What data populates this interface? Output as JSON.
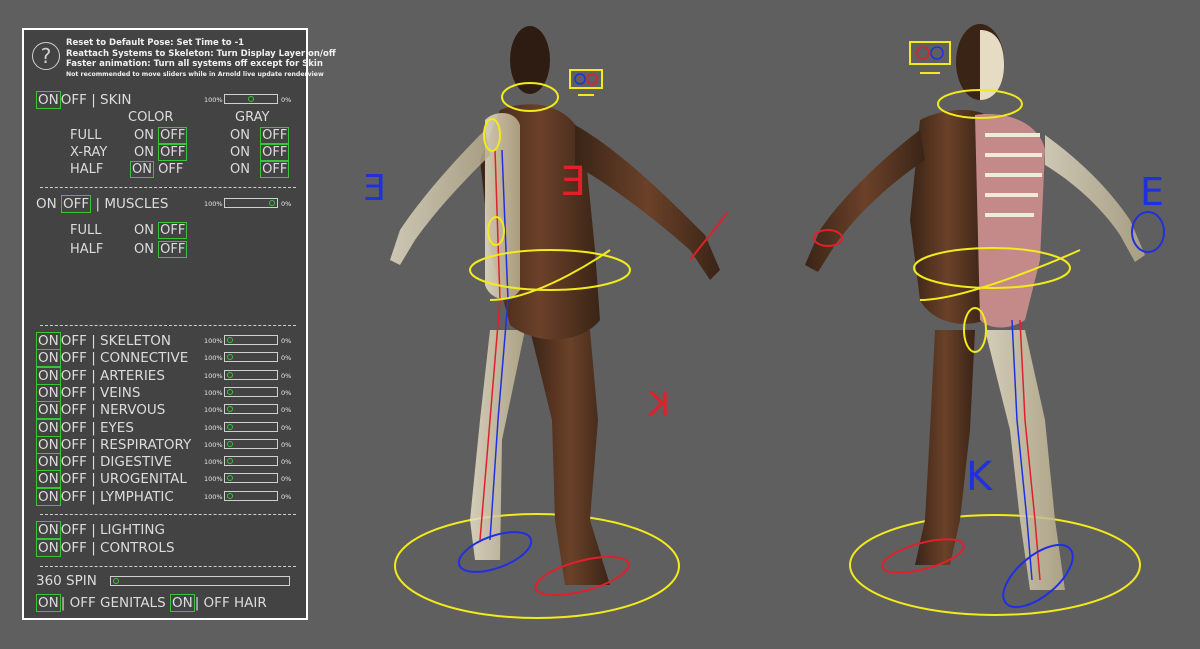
{
  "panel": {
    "help_icon": "?",
    "notes": [
      "Reset to Default Pose: Set Time to -1",
      "Reattach Systems to Skeleton: Turn Display Layer on/off",
      "Faster animation: Turn all systems off except for Skin",
      "Not recommended to move sliders while in Arnold live update renderview"
    ],
    "on_label": "ON",
    "off_label": "OFF",
    "pct_100": "100%",
    "pct_0": "0%",
    "skin": {
      "label": "| SKIN",
      "color_header": "COLOR",
      "gray_header": "GRAY",
      "rows": [
        {
          "name": "FULL",
          "color_selected": "OFF",
          "gray_selected": "OFF"
        },
        {
          "name": "X-RAY",
          "color_selected": "OFF",
          "gray_selected": "OFF"
        },
        {
          "name": "HALF",
          "color_selected": "ON",
          "gray_selected": "OFF"
        }
      ],
      "opacity": 0.5
    },
    "muscles": {
      "label": "| MUSCLES",
      "rows": [
        {
          "name": "FULL",
          "selected": "OFF"
        },
        {
          "name": "HALF",
          "selected": "OFF"
        }
      ],
      "opacity": 0.0
    },
    "systems": [
      {
        "label": "| SKELETON"
      },
      {
        "label": "| CONNECTIVE"
      },
      {
        "label": "| ARTERIES"
      },
      {
        "label": "| VEINS"
      },
      {
        "label": "| NERVOUS"
      },
      {
        "label": "| EYES"
      },
      {
        "label": "| RESPIRATORY"
      },
      {
        "label": "| DIGESTIVE"
      },
      {
        "label": "| UROGENITAL"
      },
      {
        "label": "| LYMPHATIC"
      }
    ],
    "scene": [
      {
        "label": "| LIGHTING"
      },
      {
        "label": "| CONTROLS"
      }
    ],
    "spin_label": "360 SPIN",
    "genitals_label": "GENITALS",
    "hair_label": "HAIR",
    "sep_pipe": "|"
  },
  "colors": {
    "accent_green": "#3ac43a",
    "panel_bg": "#434343",
    "viewport_bg": "#5f5f5f",
    "control_yellow": "#f2ea1a",
    "control_red": "#e0202a",
    "control_blue": "#2030e0"
  },
  "viewport": {
    "glyph_e": "E",
    "glyph_k": "K"
  }
}
